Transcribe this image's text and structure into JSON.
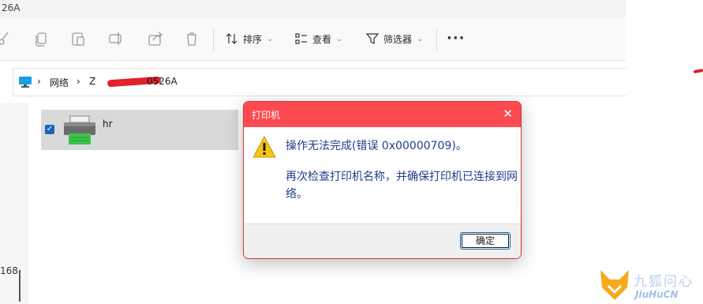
{
  "window": {
    "title_fragment": "26A"
  },
  "toolbar": {
    "sort_label": "排序",
    "view_label": "查看",
    "filter_label": "筛选器",
    "more_label": "···",
    "chevron": "⌄"
  },
  "address": {
    "network_label": "网络",
    "server_start": "Z",
    "server_end": "0526A",
    "separator": "›"
  },
  "left_pane": {
    "number": "168"
  },
  "items": [
    {
      "name": "hr",
      "checked": true
    }
  ],
  "dialog": {
    "title": "打印机",
    "close": "✕",
    "message_line1": "操作无法完成(错误 0x00000709)。",
    "message_line2": "再次检查打印机名称，并确保打印机已连接到网络。",
    "ok_label": "确定"
  },
  "watermark": {
    "cn": "九狐问心",
    "en": "JiuHuCN"
  },
  "colors": {
    "dialog_title": "#fd4a50",
    "message_text": "#1f3e8c",
    "selection": "#d9d9d9"
  }
}
